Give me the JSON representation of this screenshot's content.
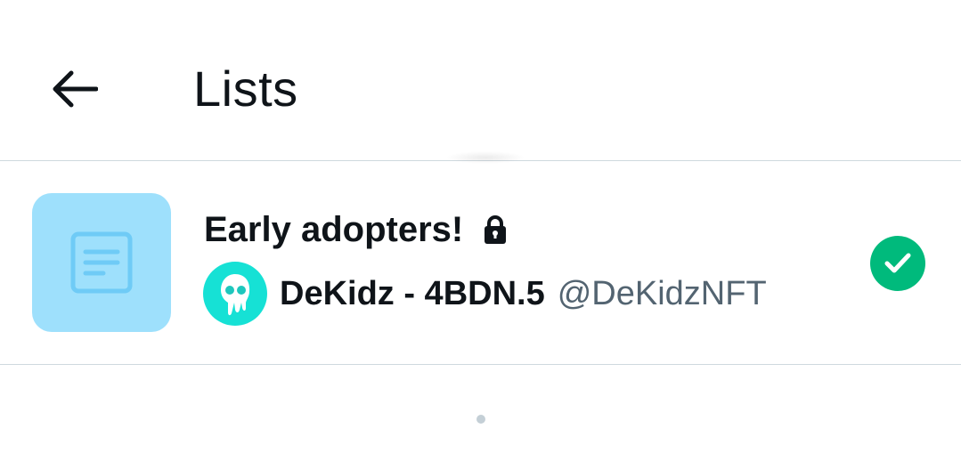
{
  "header": {
    "back_icon": "arrow-left-icon",
    "title": "Lists"
  },
  "lists": [
    {
      "name": "Early adopters!",
      "private": true,
      "lock_icon": "lock-icon",
      "thumbnail_icon": "list-document-icon",
      "owner": {
        "display_name": "DeKidz - 4BDN.5",
        "handle": "@DeKidzNFT"
      },
      "selected": true,
      "check_icon": "checkmark-icon"
    }
  ],
  "pagination": {
    "dot_icon": "page-indicator-dot"
  },
  "colors": {
    "thumbnail_bg": "#9ee0fc",
    "thumbnail_icon": "#6fcbf6",
    "avatar_bg": "#16e1d5",
    "check_bg": "#00ba7c",
    "handle_text": "#536471",
    "divider": "#cfd9de"
  }
}
